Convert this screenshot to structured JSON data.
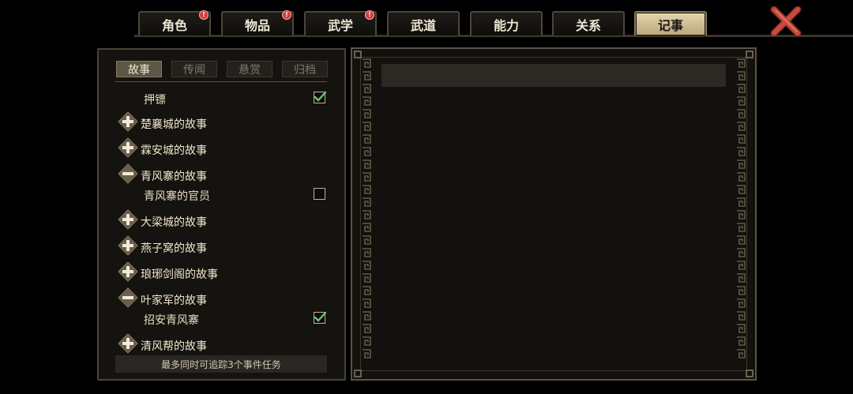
{
  "tabs": [
    {
      "label": "角色",
      "alert": true
    },
    {
      "label": "物品",
      "alert": true
    },
    {
      "label": "武学",
      "alert": true
    },
    {
      "label": "武道",
      "alert": false
    },
    {
      "label": "能力",
      "alert": false
    },
    {
      "label": "关系",
      "alert": false
    },
    {
      "label": "记事",
      "alert": false,
      "active": true
    }
  ],
  "alert_mark": "!",
  "subtabs": [
    {
      "label": "故事",
      "active": true
    },
    {
      "label": "传闻",
      "active": false
    },
    {
      "label": "悬赏",
      "active": false
    },
    {
      "label": "归档",
      "active": false
    }
  ],
  "entries": [
    {
      "type": "quest",
      "label": "押镖",
      "checked": true
    },
    {
      "type": "group",
      "label": "楚襄城的故事",
      "expanded": false
    },
    {
      "type": "group",
      "label": "霖安城的故事",
      "expanded": false
    },
    {
      "type": "group",
      "label": "青风寨的故事",
      "expanded": true
    },
    {
      "type": "quest",
      "label": "青风寨的官员",
      "checked": false
    },
    {
      "type": "group",
      "label": "大梁城的故事",
      "expanded": false
    },
    {
      "type": "group",
      "label": "燕子窝的故事",
      "expanded": false
    },
    {
      "type": "group",
      "label": "琅琊剑阁的故事",
      "expanded": false
    },
    {
      "type": "group",
      "label": "叶家军的故事",
      "expanded": true
    },
    {
      "type": "quest",
      "label": "招安青风寨",
      "checked": true
    },
    {
      "type": "group",
      "label": "清风帮的故事",
      "expanded": false
    }
  ],
  "footer_text": "最多同时可追踪3个事件任务",
  "colors": {
    "gold": "#d8c79c",
    "check_green": "#6fc07a",
    "close_red": "#c84a3e"
  }
}
